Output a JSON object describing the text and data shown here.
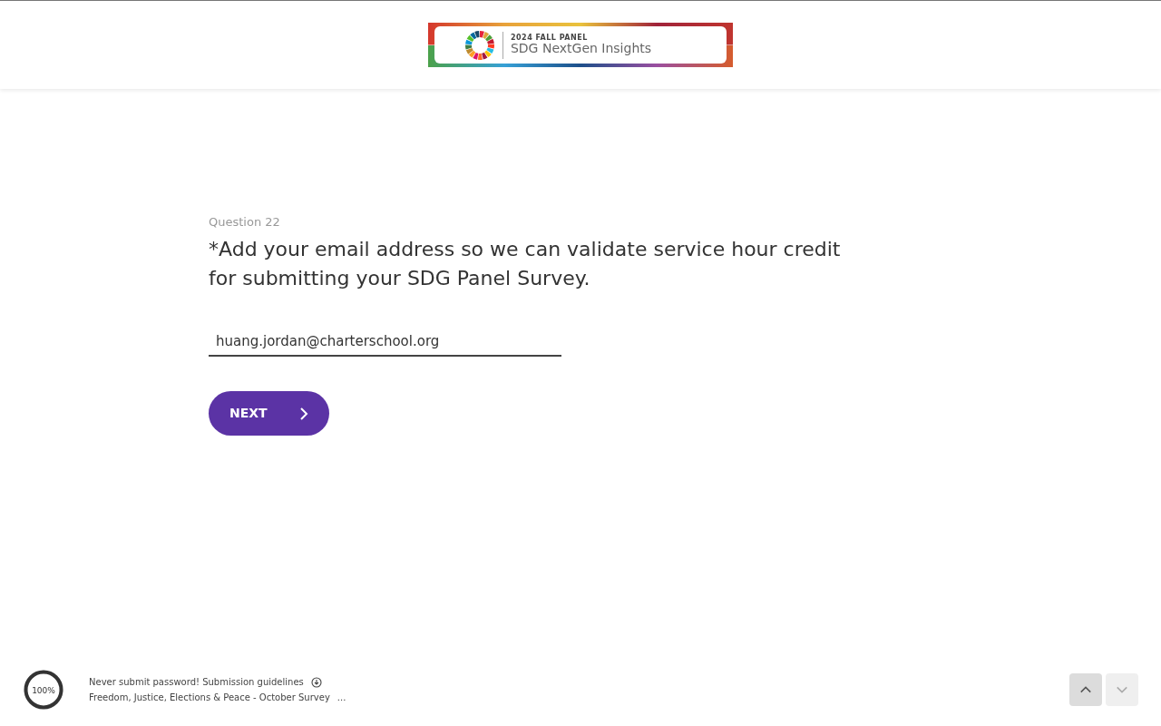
{
  "banner": {
    "eyebrow": "2024 FALL PANEL",
    "title": "SDG NextGen Insights"
  },
  "question": {
    "number": "Question 22",
    "text": "*Add your email address so we can validate service hour credit for submitting your SDG Panel Survey."
  },
  "answer": {
    "value": "huang.jordan@charterschool.org"
  },
  "next_button": {
    "label": "NEXT"
  },
  "footer": {
    "progress": {
      "level": 1,
      "reading": "100%"
    },
    "notice": "Never submit password! Submission guidelines",
    "survey_title": "Freedom, Justice, Elections & Peace - October Survey",
    "more": "..."
  },
  "nav_buttons": [
    {
      "kind": "up",
      "disabled": false
    },
    {
      "kind": "down",
      "disabled": true
    }
  ]
}
